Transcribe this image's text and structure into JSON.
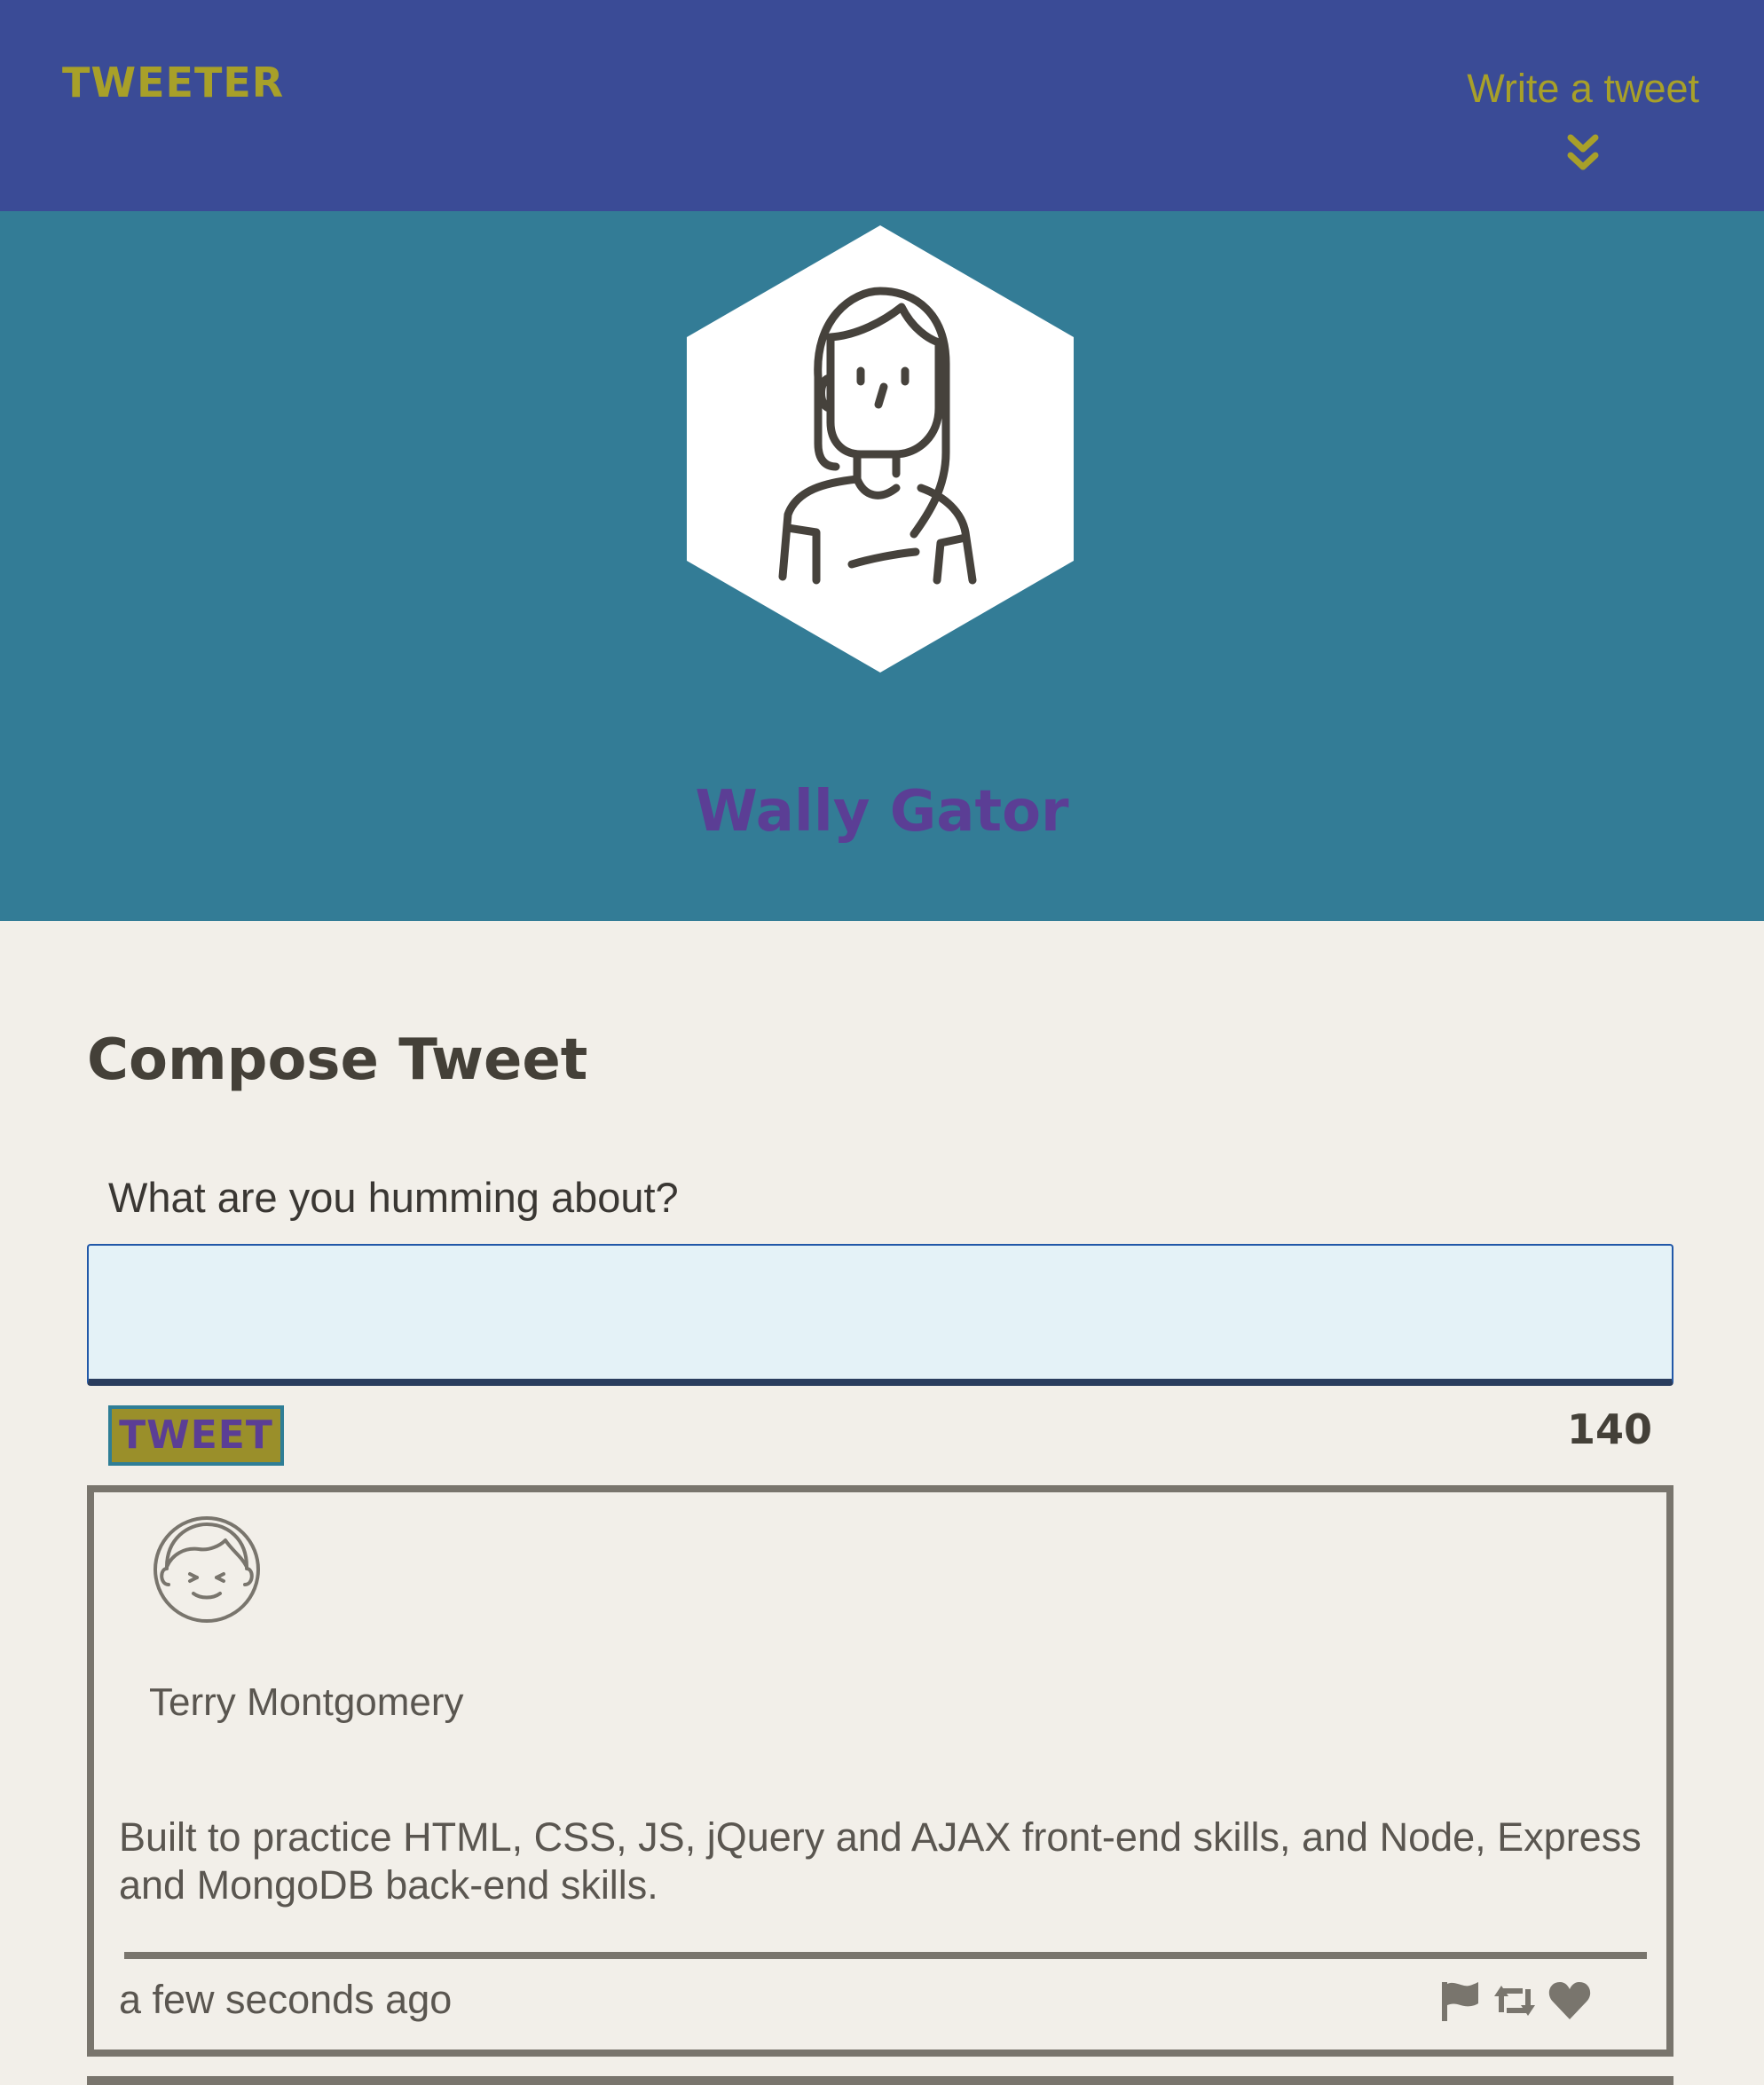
{
  "nav": {
    "brand": "TWEETER",
    "write_tweet": "Write a tweet",
    "write_tweet_icon": "double-chevron-down-icon"
  },
  "profile": {
    "name": "Wally Gator",
    "avatar_icon": "woman-avatar-icon"
  },
  "compose": {
    "title": "Compose Tweet",
    "label": "What are you humming about?",
    "input_value": "",
    "button_label": "TWEET",
    "counter": "140"
  },
  "tweets": [
    {
      "author": "Terry Montgomery",
      "avatar_icon": "man-avatar-icon",
      "content": "Built to practice HTML, CSS, JS, jQuery and AJAX front-end skills, and Node, Express and MongoDB back-end skills.",
      "time": "a few seconds ago",
      "actions": [
        "flag-icon",
        "retweet-icon",
        "heart-icon"
      ]
    }
  ],
  "colors": {
    "nav_bg": "#3a4b96",
    "banner_bg": "#337c96",
    "accent_olive": "#a8a029",
    "name_purple": "#5b3e95",
    "page_bg": "#f2efe9",
    "card_border": "#79756d"
  }
}
